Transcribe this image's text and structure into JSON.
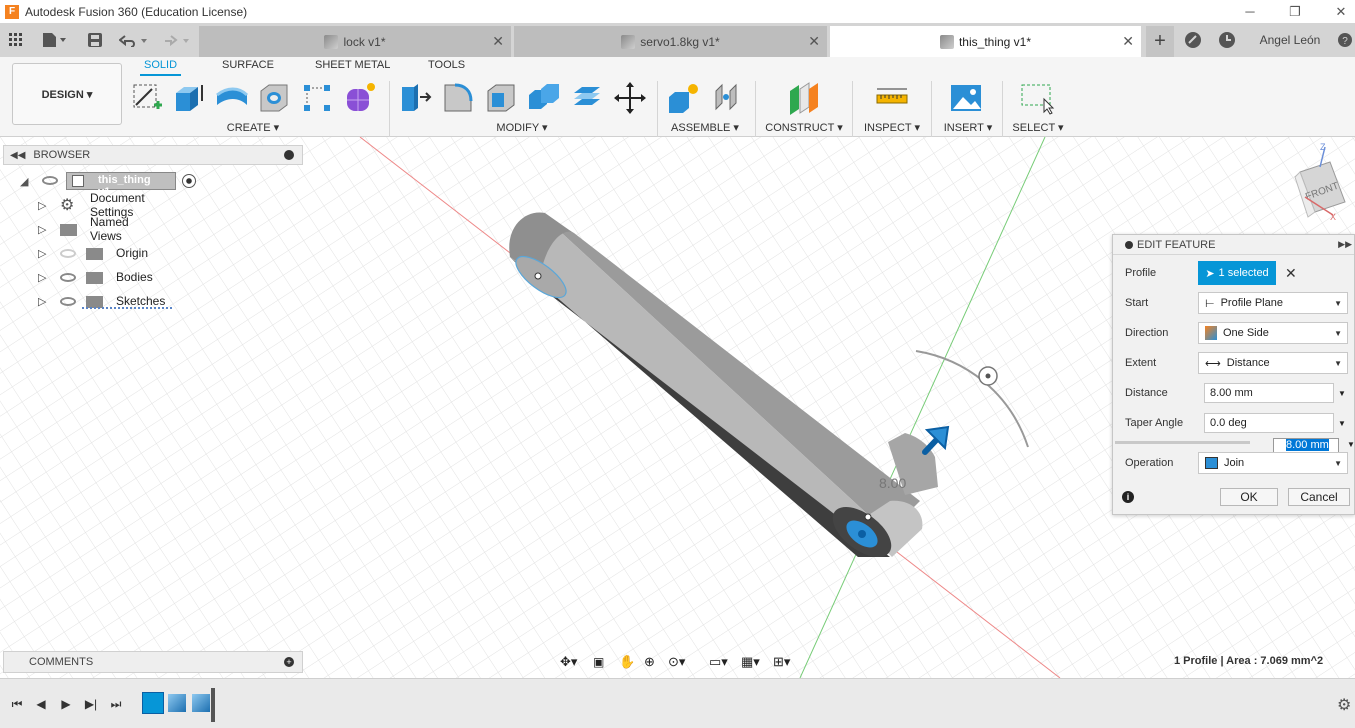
{
  "window": {
    "title": "Autodesk Fusion 360 (Education License)",
    "app_icon": "F"
  },
  "tabs": [
    {
      "label": "lock v1*",
      "active": false
    },
    {
      "label": "servo1.8kg v1*",
      "active": false
    },
    {
      "label": "this_thing v1*",
      "active": true
    }
  ],
  "user": {
    "name": "Angel León"
  },
  "toolbar": {
    "workspace_button": "DESIGN ▾",
    "workspace_tabs": [
      "SOLID",
      "SURFACE",
      "SHEET METAL",
      "TOOLS"
    ],
    "groups": {
      "create": "CREATE ▾",
      "modify": "MODIFY ▾",
      "assemble": "ASSEMBLE ▾",
      "construct": "CONSTRUCT ▾",
      "inspect": "INSPECT ▾",
      "insert": "INSERT ▾",
      "select": "SELECT ▾"
    }
  },
  "browser": {
    "title": "BROWSER",
    "root": "this_thing v1",
    "items": [
      "Document Settings",
      "Named Views",
      "Origin",
      "Bodies",
      "Sketches"
    ]
  },
  "comments": {
    "title": "COMMENTS"
  },
  "viewcube": {
    "face": "FRONT",
    "axis_z": "Z",
    "axis_x": "X"
  },
  "edit_feature": {
    "title": "EDIT FEATURE",
    "profile_label": "Profile",
    "profile_value": "1 selected",
    "start_label": "Start",
    "start_value": "Profile Plane",
    "direction_label": "Direction",
    "direction_value": "One Side",
    "extent_label": "Extent",
    "extent_value": "Distance",
    "distance_label": "Distance",
    "distance_value": "8.00 mm",
    "taper_label": "Taper Angle",
    "taper_value": "0.0 deg",
    "inline_value": "8.00 mm",
    "operation_label": "Operation",
    "operation_value": "Join",
    "ok": "OK",
    "cancel": "Cancel"
  },
  "viewport": {
    "dimension_label": "8.00"
  },
  "status": {
    "text": "1 Profile | Area : 7.069 mm^2"
  }
}
